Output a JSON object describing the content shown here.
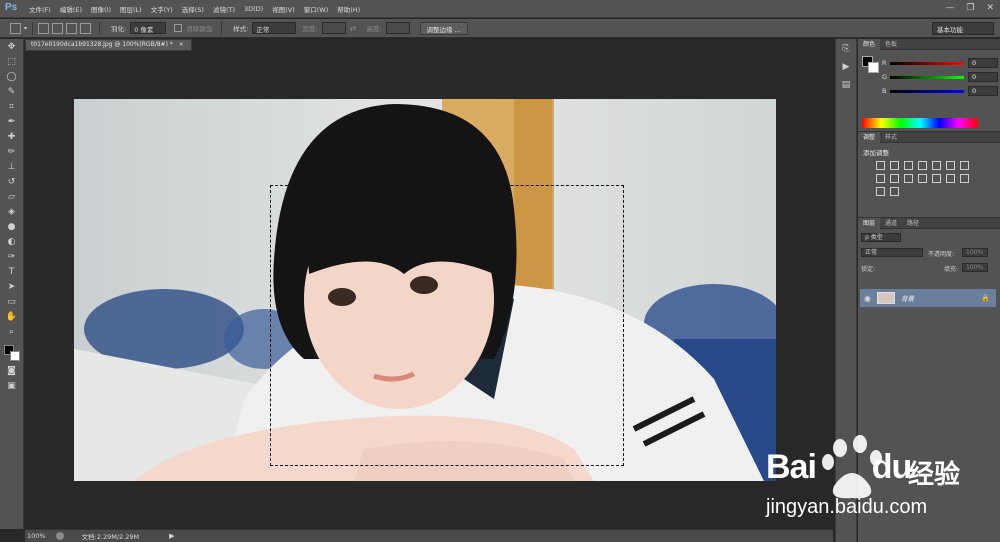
{
  "app": {
    "logo": "Ps"
  },
  "menu": [
    "文件(F)",
    "编辑(E)",
    "图像(I)",
    "图层(L)",
    "文字(Y)",
    "选择(S)",
    "滤镜(T)",
    "3D(D)",
    "视图(V)",
    "窗口(W)",
    "帮助(H)"
  ],
  "window_controls": {
    "minimize": "—",
    "restore": "❐",
    "close": "✕"
  },
  "options": {
    "feather_label": "羽化:",
    "feather_value": "0 像素",
    "antialias_label": "消除锯齿",
    "style_label": "样式:",
    "style_value": "正常",
    "width_label": "宽度:",
    "height_label": "高度:",
    "refine_button": "调整边缘 ...",
    "workspace": "基本功能"
  },
  "document": {
    "tab_title": "t017e0190dca1b91328.jpg @ 100%(RGB/8#) *",
    "tab_close": "×",
    "zoom": "100%",
    "doc_size": "文档:2.29M/2.29M"
  },
  "color_panel": {
    "tabs": [
      "颜色",
      "色板"
    ],
    "channels": [
      {
        "name": "R",
        "value": "0",
        "color": "#d22020"
      },
      {
        "name": "G",
        "value": "0",
        "color": "#20b020"
      },
      {
        "name": "B",
        "value": "0",
        "color": "#2040d0"
      }
    ]
  },
  "adjust_panel": {
    "tabs": [
      "调整",
      "样式"
    ],
    "title": "添加调整"
  },
  "layers_panel": {
    "tabs": [
      "图层",
      "通道",
      "路径"
    ],
    "filter_label": "ρ 类型",
    "blend_mode": "正常",
    "opacity_label": "不透明度:",
    "opacity_value": "100%",
    "lock_label": "锁定:",
    "fill_label": "填充:",
    "fill_value": "100%",
    "layers": [
      {
        "name": "背景"
      }
    ]
  },
  "watermark": {
    "brand": "Bai",
    "brand2": "du",
    "product": "经验",
    "url": "jingyan.baidu.com"
  }
}
